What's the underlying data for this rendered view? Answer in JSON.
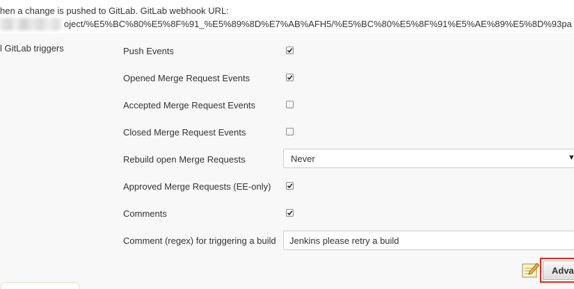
{
  "description": {
    "line1": "hen a change is pushed to GitLab. GitLab webhook URL:",
    "line2": "oject/%E5%BC%80%E5%8F%91_%E5%89%8D%E7%AB%AFH5/%E5%BC%80%E5%8F%91%E5%AE%89%E5%8D%93pa"
  },
  "section_label": "l GitLab triggers",
  "triggers": [
    {
      "label": "Push Events",
      "checked": true
    },
    {
      "label": "Opened Merge Request Events",
      "checked": true
    },
    {
      "label": "Accepted Merge Request Events",
      "checked": false
    },
    {
      "label": "Closed Merge Request Events",
      "checked": false
    }
  ],
  "rebuild": {
    "label": "Rebuild open Merge Requests",
    "selected": "Never"
  },
  "triggers_after": [
    {
      "label": "Approved Merge Requests (EE-only)",
      "checked": true
    },
    {
      "label": "Comments",
      "checked": true
    }
  ],
  "comment_regex": {
    "label": "Comment (regex) for triggering a build",
    "value": "Jenkins please retry a build"
  },
  "advanced_button": {
    "label": "Advan"
  },
  "icons": {
    "checkbox_check": "checkmark-icon",
    "select_arrow": "chevron-down-icon",
    "notes": "notepad-icon"
  },
  "colors": {
    "highlight_border": "#e0261b",
    "panel_background": "#f8f8f8"
  }
}
